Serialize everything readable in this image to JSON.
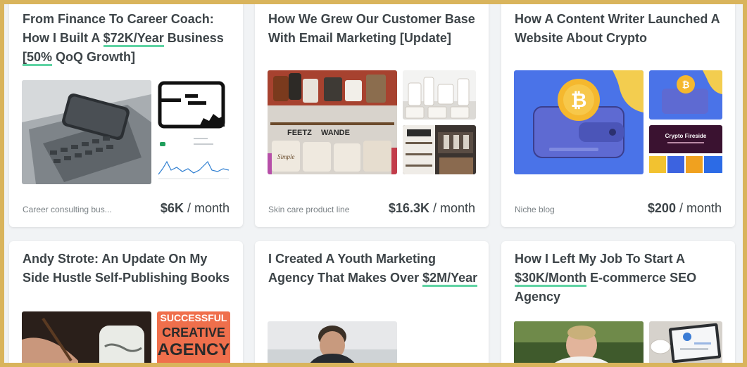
{
  "cards": [
    {
      "title_parts": [
        "From Finance To Career Coach: How I Built A ",
        "$72K/Year",
        " Business ",
        "[50%",
        " QoQ Growth]"
      ],
      "category": "Career consulting bus...",
      "revenue": "$6K",
      "period": "/ month"
    },
    {
      "title": "How We Grew Our Customer Base With Email Marketing [Update]",
      "category": "Skin care product line",
      "revenue": "$16.3K",
      "period": "/ month",
      "image_text": [
        "FEETZ",
        "WANDE",
        "Simple"
      ]
    },
    {
      "title": "How A Content Writer Launched A Website About Crypto",
      "category": "Niche blog",
      "revenue": "$200",
      "period": "/ month",
      "image_text": [
        "Crypto Fireside"
      ]
    },
    {
      "title": "Andy Strote: An Update On My Side Hustle Self-Publishing Books",
      "image_text": [
        "SUCCESSFUL",
        "CREATIVE",
        "AGENCY"
      ]
    },
    {
      "title_parts": [
        "I Created A Youth Marketing Agency That Makes Over ",
        "$2M/Year"
      ]
    },
    {
      "title_parts": [
        "How I Left My Job To Start A ",
        "$30K/Month",
        " E-commerce SEO Agency"
      ]
    }
  ],
  "colors": {
    "border": "#d9b45c",
    "background": "#f1f3f5",
    "highlight": "#5fd3a3",
    "text": "#3d4448",
    "muted": "#7b8286"
  }
}
